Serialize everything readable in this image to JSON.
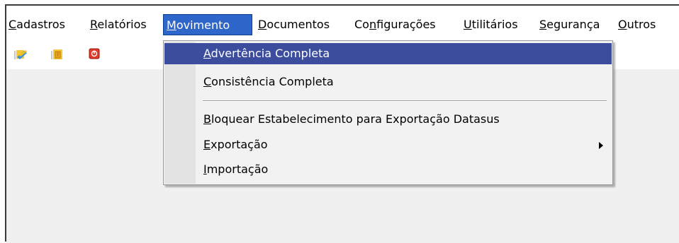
{
  "menubar": {
    "items": [
      {
        "label": "Cadastros",
        "accel": "C",
        "rest": "adastros"
      },
      {
        "label": "Relatórios",
        "accel": "R",
        "rest": "elatórios"
      },
      {
        "label": "Movimento",
        "accel": "M",
        "rest": "ovimento"
      },
      {
        "label": "Documentos",
        "accel": "D",
        "rest": "ocumentos"
      },
      {
        "label": "Configurações",
        "pre": "Co",
        "accel": "n",
        "rest": "figurações"
      },
      {
        "label": "Utilitários",
        "accel": "U",
        "rest": "tilitários"
      },
      {
        "label": "Segurança",
        "accel": "S",
        "rest": "egurança"
      },
      {
        "label": "Outros",
        "accel": "O",
        "rest": "utros"
      }
    ]
  },
  "toolbar": {
    "icons": [
      "folder-edit-icon",
      "folder-document-icon",
      "power-icon"
    ]
  },
  "dropdown": {
    "items": [
      {
        "label": "Advertência Completa",
        "accel": "A",
        "rest": "dvertência Completa"
      },
      {
        "label": "Consistência Completa",
        "accel": "C",
        "rest": "onsistência Completa"
      },
      {
        "label": "Bloquear Estabelecimento para Exportação Datasus",
        "accel": "B",
        "rest": "loquear Estabelecimento para Exportação Datasus"
      },
      {
        "label": "Exportação",
        "accel": "E",
        "rest": "xportação"
      },
      {
        "label": "Importação",
        "accel": "I",
        "rest": "mportação"
      }
    ]
  },
  "colors": {
    "highlight": "#3b4d9c",
    "active_menu": "#2f66c9"
  }
}
